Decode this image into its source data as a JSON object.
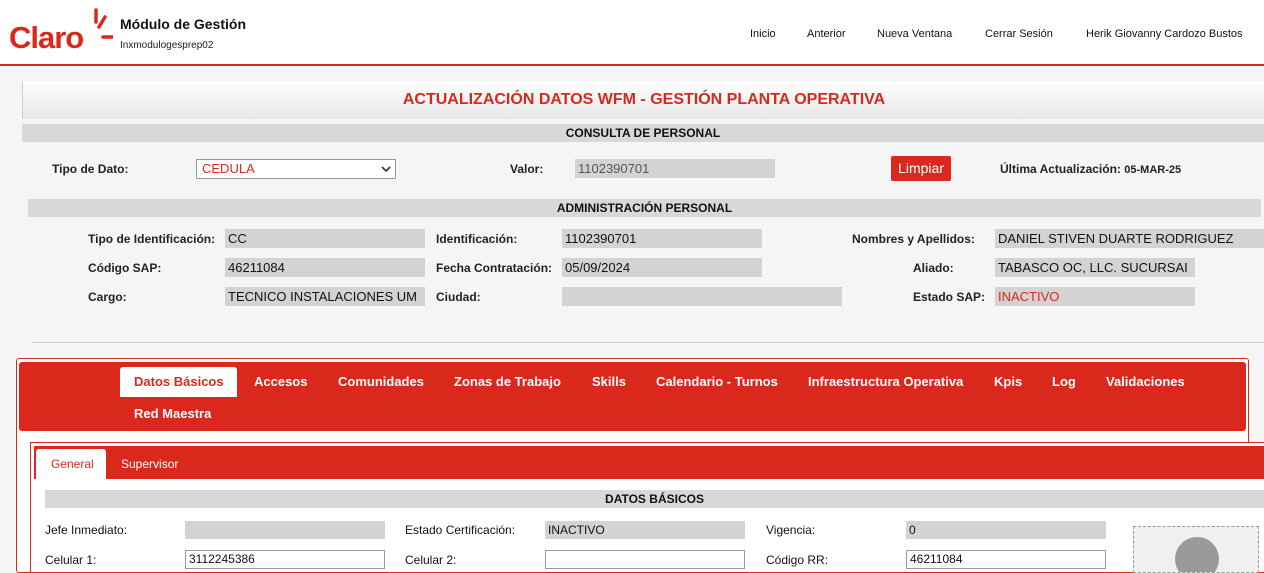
{
  "header": {
    "logo_text": "Claro",
    "app_title": "Módulo de Gestión",
    "app_subtitle": "Inxmodulogesprep02",
    "nav": {
      "inicio": "Inicio",
      "anterior": "Anterior",
      "nueva_ventana": "Nueva Ventana",
      "cerrar_sesion": "Cerrar Sesión",
      "user": "Herik Giovanny Cardozo Bustos"
    }
  },
  "page_title": "ACTUALIZACIÓN DATOS WFM - GESTIÓN PLANTA OPERATIVA",
  "consulta": {
    "section_title": "CONSULTA DE PERSONAL",
    "tipo_label": "Tipo de Dato:",
    "tipo_value": "CEDULA",
    "valor_label": "Valor:",
    "valor_value": "1102390701",
    "limpiar": "Limpiar",
    "ultima_label": "Última Actualización:",
    "ultima_value": "05-MAR-25"
  },
  "admin": {
    "section_title": "ADMINISTRACIÓN PERSONAL",
    "tipo_id_label": "Tipo de Identificación:",
    "tipo_id_value": "CC",
    "identificacion_label": "Identificación:",
    "identificacion_value": "1102390701",
    "nombres_label": "Nombres y Apellidos:",
    "nombres_value": "DANIEL STIVEN DUARTE RODRIGUEZ",
    "codigo_sap_label": "Código SAP:",
    "codigo_sap_value": "46211084",
    "fecha_label": "Fecha Contratación:",
    "fecha_value": "05/09/2024",
    "aliado_label": "Aliado:",
    "aliado_value": "TABASCO OC, LLC. SUCURSAI",
    "cargo_label": "Cargo:",
    "cargo_value": "TECNICO INSTALACIONES UM",
    "ciudad_label": "Ciudad:",
    "ciudad_value": "",
    "estado_sap_label": "Estado SAP:",
    "estado_sap_value": "INACTIVO"
  },
  "main_tabs": {
    "datos_basicos": "Datos Básicos",
    "accesos": "Accesos",
    "comunidades": "Comunidades",
    "zonas": "Zonas de Trabajo",
    "skills": "Skills",
    "calendario": "Calendario - Turnos",
    "infraestructura": "Infraestructura Operativa",
    "kpis": "Kpis",
    "log": "Log",
    "validaciones": "Validaciones",
    "red_maestra": "Red Maestra"
  },
  "sub_tabs": {
    "general": "General",
    "supervisor": "Supervisor"
  },
  "datos_basicos": {
    "section_title": "DATOS BÁSICOS",
    "jefe_label": "Jefe Inmediato:",
    "jefe_value": "",
    "estado_cert_label": "Estado Certificación:",
    "estado_cert_value": "INACTIVO",
    "vigencia_label": "Vigencia:",
    "vigencia_value": "0",
    "celular1_label": "Celular 1:",
    "celular1_value": "3112245386",
    "celular2_label": "Celular 2:",
    "celular2_value": "",
    "codigo_rr_label": "Código RR:",
    "codigo_rr_value": "46211084"
  },
  "colors": {
    "brand_red": "#da291c",
    "field_grey": "#d3d3d3"
  }
}
